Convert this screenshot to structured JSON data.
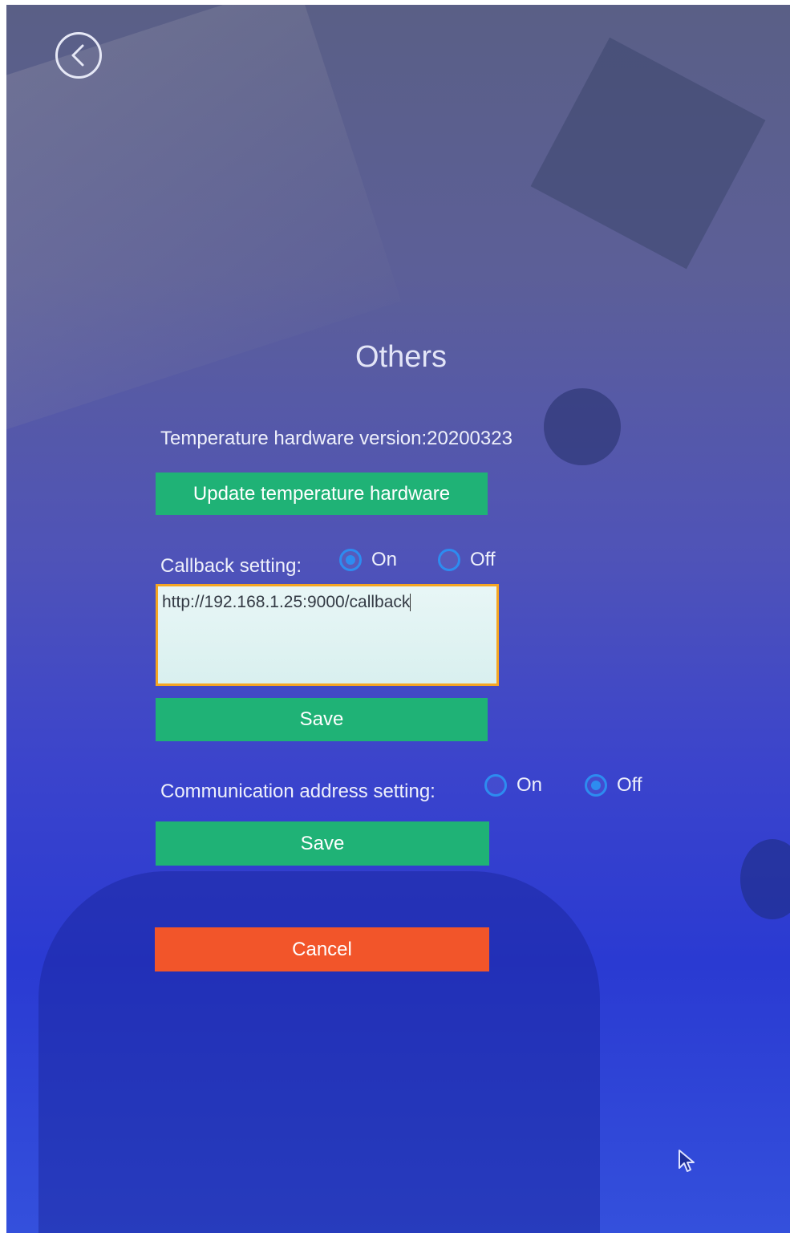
{
  "header": {
    "back_icon": "chevron-left-circle-icon"
  },
  "page": {
    "title": "Others"
  },
  "temperature": {
    "version_text": "Temperature hardware version:20200323",
    "update_button": "Update temperature hardware"
  },
  "callback": {
    "label": "Callback setting:",
    "options": [
      {
        "label": "On",
        "selected": true
      },
      {
        "label": "Off",
        "selected": false
      }
    ],
    "url_value": "http://192.168.1.25:9000/callback",
    "save_button": "Save"
  },
  "communication": {
    "label": "Communication address setting:",
    "options": [
      {
        "label": "On",
        "selected": false
      },
      {
        "label": "Off",
        "selected": true
      }
    ],
    "save_button": "Save"
  },
  "actions": {
    "cancel_button": "Cancel"
  },
  "colors": {
    "save_green": "#1fb276",
    "cancel_red": "#f2552a",
    "radio_blue": "#2d8cf0",
    "input_border": "#f5a623"
  }
}
